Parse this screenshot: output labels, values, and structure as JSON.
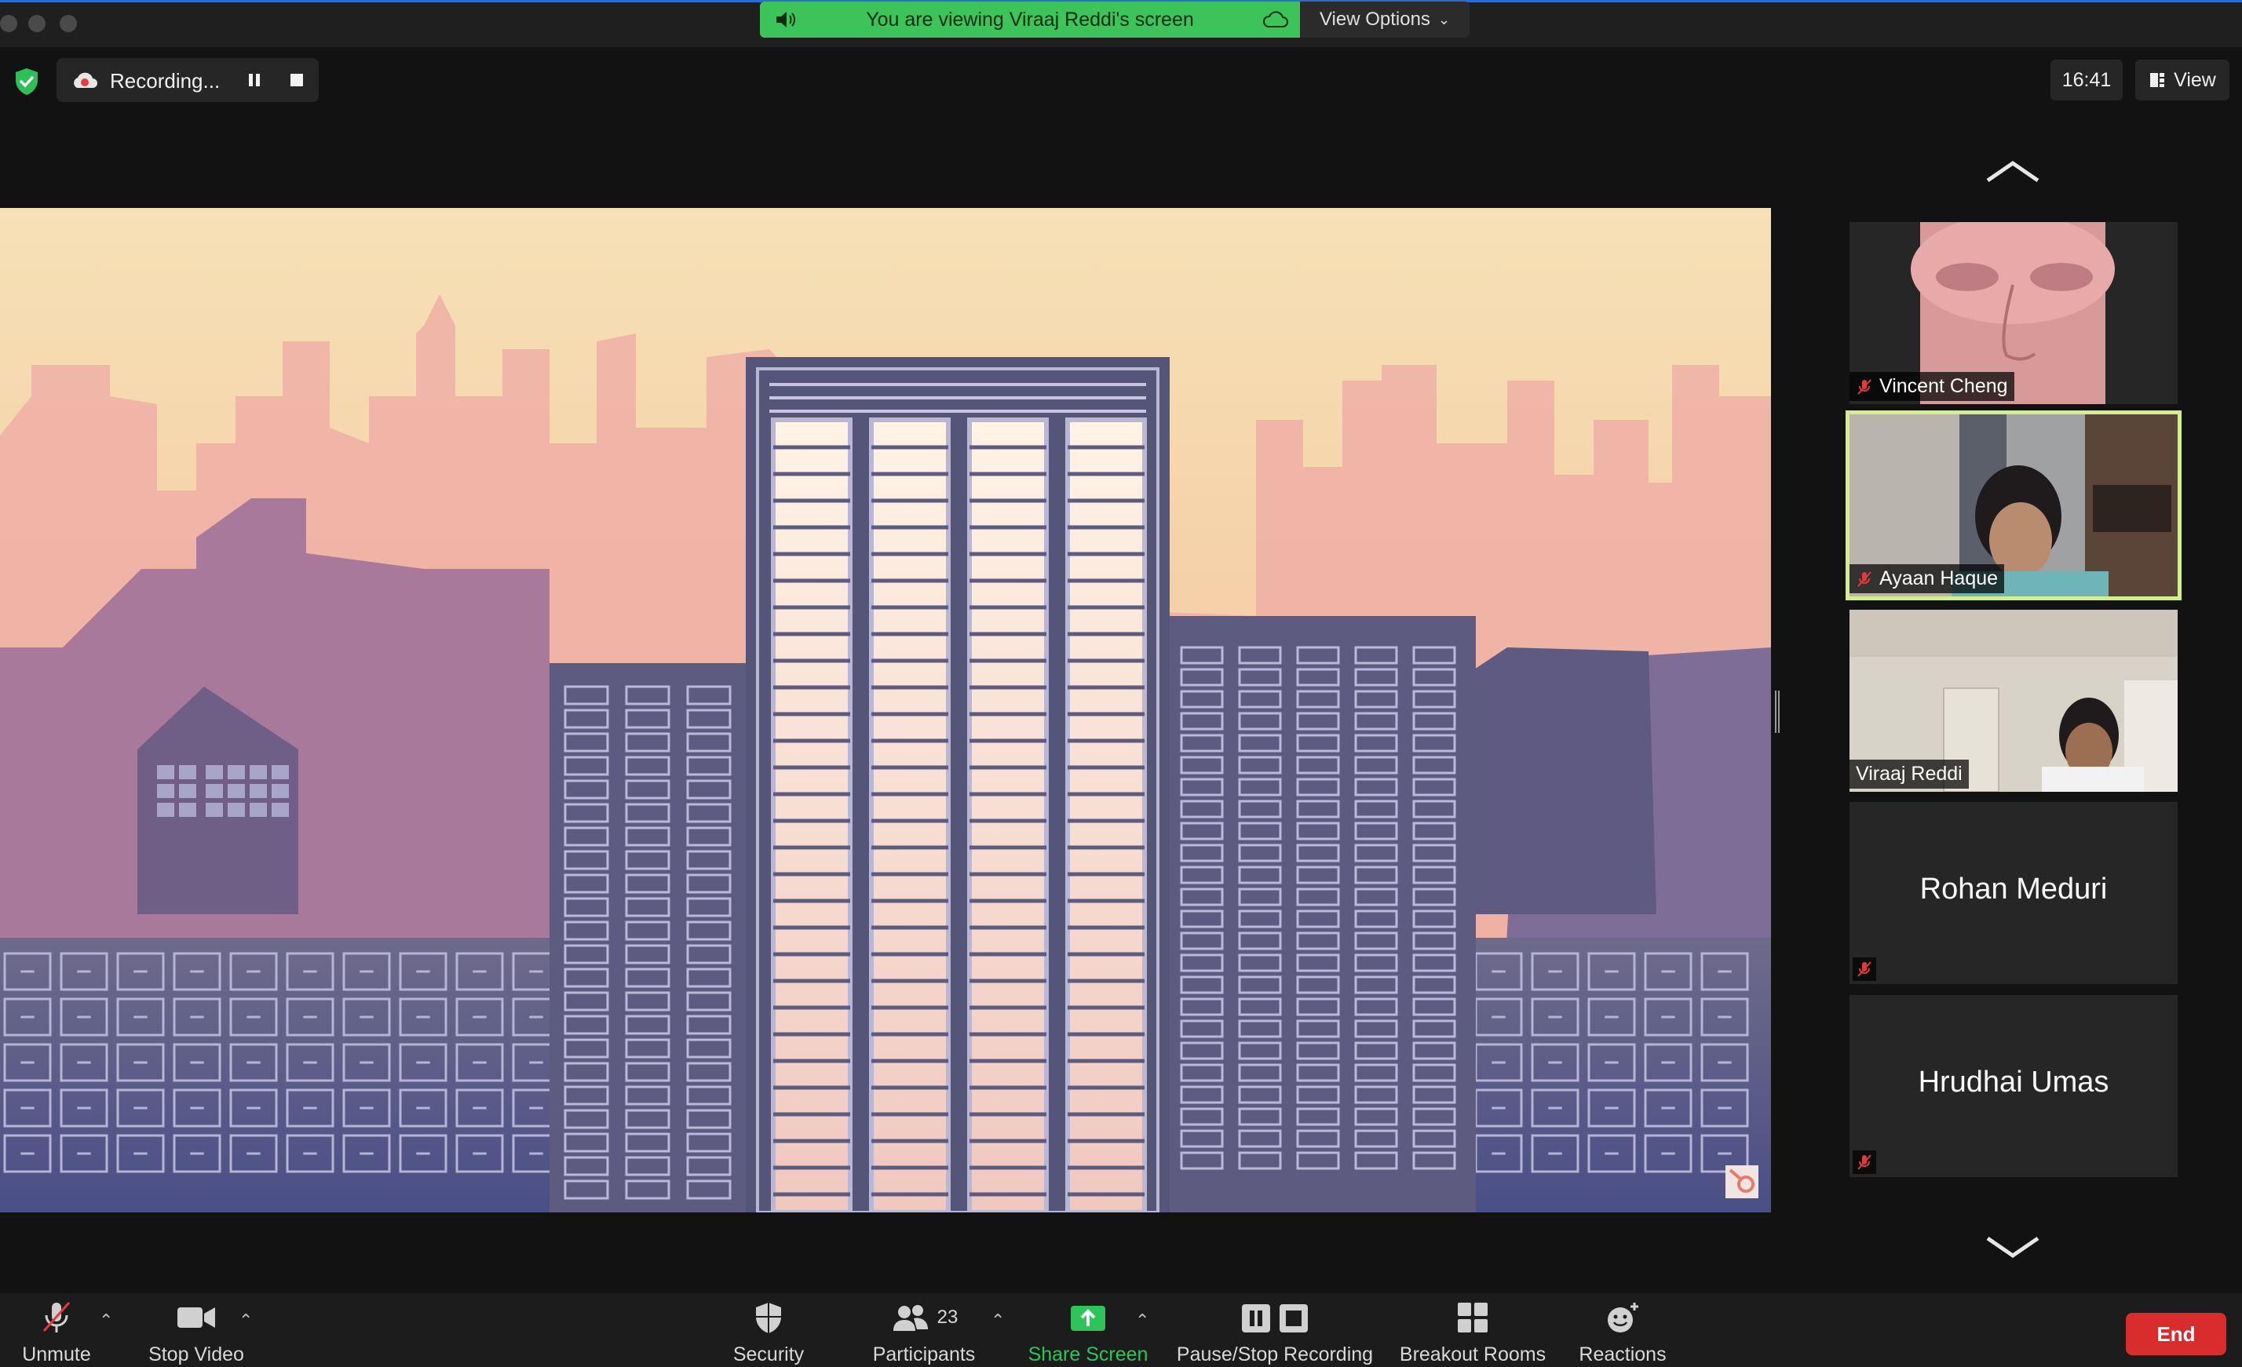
{
  "window": {
    "banner_text": "You are viewing Viraaj Reddi's screen",
    "view_options_label": "View Options"
  },
  "recording": {
    "status_label": "Recording..."
  },
  "topright": {
    "time": "16:41",
    "view_label": "View"
  },
  "participants_panel": {
    "tiles": [
      {
        "name": "Vincent Cheng",
        "muted": true,
        "video": true
      },
      {
        "name": "Ayaan Haque",
        "muted": true,
        "video": true,
        "active_speaker": true
      },
      {
        "name": "Viraaj Reddi",
        "muted": false,
        "video": true
      },
      {
        "name": "Rohan Meduri",
        "muted": true,
        "video": false
      },
      {
        "name": "Hrudhai Umas",
        "muted": true,
        "video": false
      }
    ]
  },
  "toolbar": {
    "unmute": "Unmute",
    "stop_video": "Stop Video",
    "security": "Security",
    "participants": "Participants",
    "participants_count": "23",
    "share_screen": "Share Screen",
    "pause_stop_recording": "Pause/Stop Recording",
    "breakout_rooms": "Breakout Rooms",
    "reactions": "Reactions",
    "end": "End"
  },
  "colors": {
    "banner_green": "#3cc35a",
    "share_green": "#2ec45a",
    "end_red": "#d92d2d",
    "active_speaker_outline": "#d4ee8e",
    "mute_red": "#e03a3a"
  }
}
